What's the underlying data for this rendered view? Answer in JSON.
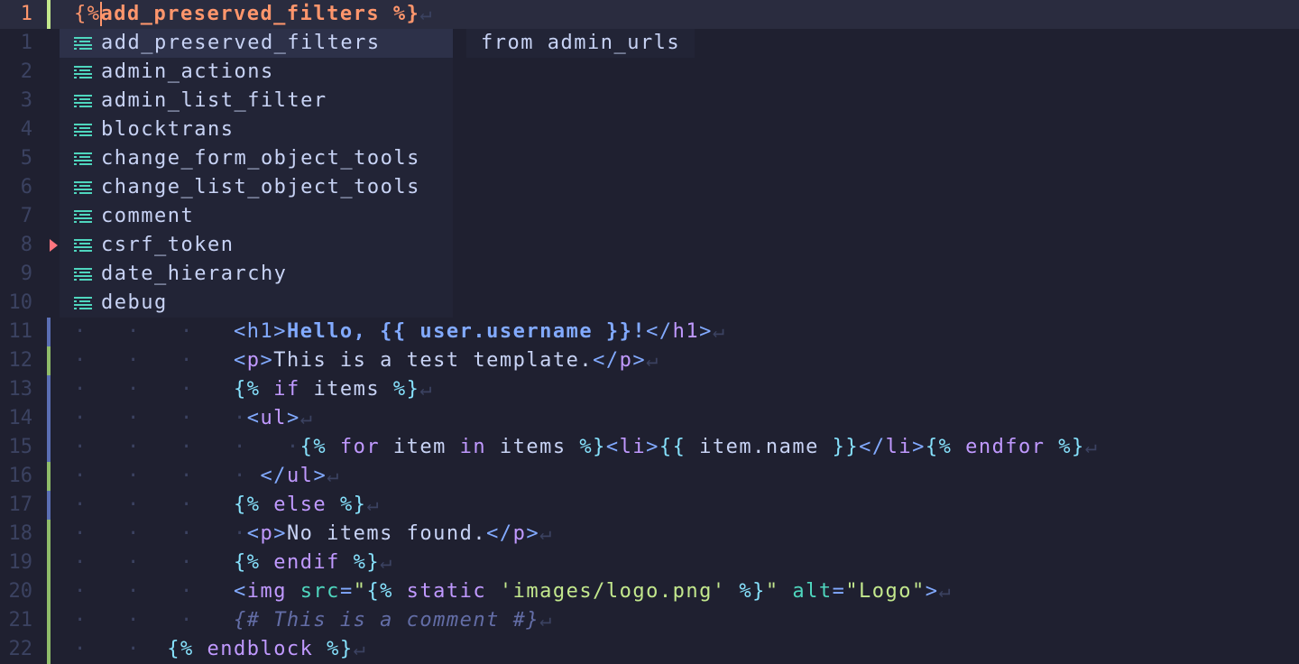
{
  "editor": {
    "current_line": {
      "number": "1",
      "open": "{%",
      "text": "add_preserved_filters",
      "close": " %}",
      "eol": "↵"
    },
    "relative_numbers": [
      "1",
      "2",
      "3",
      "4",
      "5",
      "6",
      "7",
      "8",
      "9",
      "10"
    ],
    "lines": [
      {
        "num": "11",
        "sign": "#5b6fb4",
        "tokens": [
          [
            "t-html",
            "<"
          ],
          [
            "t-html",
            "h1"
          ],
          [
            "t-html",
            ">"
          ],
          [
            "t-bold",
            "Hello, {{ user.username }}!"
          ],
          [
            "t-html",
            "</"
          ],
          [
            "t-kw",
            "h1"
          ],
          [
            "t-html",
            ">"
          ],
          [
            "t-eol",
            "↵"
          ]
        ],
        "indent": "·   ·   ·   "
      },
      {
        "num": "12",
        "sign": "#8fbc6a",
        "tokens": [
          [
            "t-html",
            "<"
          ],
          [
            "t-kw",
            "p"
          ],
          [
            "t-html",
            ">"
          ],
          [
            "t-var",
            "This is a test template."
          ],
          [
            "t-html",
            "</"
          ],
          [
            "t-kw",
            "p"
          ],
          [
            "t-html",
            ">"
          ],
          [
            "t-eol",
            "↵"
          ]
        ],
        "indent": "·   ·   ·   "
      },
      {
        "num": "13",
        "sign": "#5b6fb4",
        "tokens": [
          [
            "t-delim",
            "{%"
          ],
          [
            "t-kw",
            " if "
          ],
          [
            "t-var",
            "items"
          ],
          [
            "t-delim",
            " %}"
          ],
          [
            "t-eol",
            "↵"
          ]
        ],
        "indent": "·   ·   ·   "
      },
      {
        "num": "14",
        "sign": "#5b6fb4",
        "tokens": [
          [
            "t-html",
            "<"
          ],
          [
            "t-kw",
            "ul"
          ],
          [
            "t-html",
            ">"
          ],
          [
            "t-eol",
            "↵"
          ]
        ],
        "indent": "·   ·   ·   ·"
      },
      {
        "num": "15",
        "sign": "#5b6fb4",
        "tokens": [
          [
            "t-delim",
            "{%"
          ],
          [
            "t-kw",
            " for "
          ],
          [
            "t-var",
            "item "
          ],
          [
            "t-kw",
            "in "
          ],
          [
            "t-var",
            "items"
          ],
          [
            "t-delim",
            " %}"
          ],
          [
            "t-html",
            "<"
          ],
          [
            "t-kw",
            "li"
          ],
          [
            "t-html",
            ">"
          ],
          [
            "t-delim",
            "{{"
          ],
          [
            "t-var",
            " item.name "
          ],
          [
            "t-delim",
            "}}"
          ],
          [
            "t-html",
            "</"
          ],
          [
            "t-kw",
            "li"
          ],
          [
            "t-html",
            ">"
          ],
          [
            "t-delim",
            "{%"
          ],
          [
            "t-kw",
            " endfor"
          ],
          [
            "t-delim",
            " %}"
          ],
          [
            "t-eol",
            "↵"
          ]
        ],
        "indent": "·   ·   ·   ·   ·"
      },
      {
        "num": "16",
        "sign": "#8fbc6a",
        "tokens": [
          [
            "t-html",
            "</"
          ],
          [
            "t-kw",
            "ul"
          ],
          [
            "t-html",
            ">"
          ],
          [
            "t-eol",
            "↵"
          ]
        ],
        "indent": "·   ·   ·   · "
      },
      {
        "num": "17",
        "sign": "#5b6fb4",
        "tokens": [
          [
            "t-delim",
            "{%"
          ],
          [
            "t-kw",
            " else "
          ],
          [
            "t-delim",
            "%}"
          ],
          [
            "t-eol",
            "↵"
          ]
        ],
        "indent": "·   ·   ·   "
      },
      {
        "num": "18",
        "sign": "#8fbc6a",
        "tokens": [
          [
            "t-html",
            "<"
          ],
          [
            "t-kw",
            "p"
          ],
          [
            "t-html",
            ">"
          ],
          [
            "t-var",
            "No items found."
          ],
          [
            "t-html",
            "</"
          ],
          [
            "t-kw",
            "p"
          ],
          [
            "t-html",
            ">"
          ],
          [
            "t-eol",
            "↵"
          ]
        ],
        "indent": "·   ·   ·   ·"
      },
      {
        "num": "19",
        "sign": "#8fbc6a",
        "tokens": [
          [
            "t-delim",
            "{%"
          ],
          [
            "t-kw",
            " endif "
          ],
          [
            "t-delim",
            "%}"
          ],
          [
            "t-eol",
            "↵"
          ]
        ],
        "indent": "·   ·   ·   "
      },
      {
        "num": "20",
        "sign": "#8fbc6a",
        "tokens": [
          [
            "t-html",
            "<"
          ],
          [
            "t-kw",
            "img "
          ],
          [
            "t-attr",
            "src"
          ],
          [
            "t-html",
            "="
          ],
          [
            "t-str",
            "\""
          ],
          [
            "t-delim",
            "{%"
          ],
          [
            "t-kw",
            " static "
          ],
          [
            "t-str",
            "'images/logo.png'"
          ],
          [
            "t-delim",
            " %}"
          ],
          [
            "t-str",
            "\""
          ],
          [
            "t-attr",
            " alt"
          ],
          [
            "t-html",
            "="
          ],
          [
            "t-str",
            "\"Logo\""
          ],
          [
            "t-html",
            ">"
          ],
          [
            "t-eol",
            "↵"
          ]
        ],
        "indent": "·   ·   ·   "
      },
      {
        "num": "21",
        "sign": "#8fbc6a",
        "tokens": [
          [
            "t-comment",
            "{# This is a comment #}"
          ],
          [
            "t-eol",
            "↵"
          ]
        ],
        "indent": "·   ·   ·   "
      },
      {
        "num": "22",
        "sign": "#8fbc6a",
        "tokens": [
          [
            "t-delim",
            "{%"
          ],
          [
            "t-kw",
            " endblock "
          ],
          [
            "t-delim",
            "%}"
          ],
          [
            "t-eol",
            "↵"
          ]
        ],
        "indent": "·   ·  "
      }
    ]
  },
  "completion": {
    "selected_index": 0,
    "items": [
      "add_preserved_filters",
      "admin_actions",
      "admin_list_filter",
      "blocktrans",
      "change_form_object_tools",
      "change_list_object_tools",
      "comment",
      "csrf_token",
      "date_hierarchy",
      "debug"
    ],
    "item_icon": "text-snippet-icon",
    "doc": "from admin_urls"
  },
  "colors": {
    "background": "#1f2030",
    "current_line_number": "#ff966c",
    "git_added": "#8fbc6a",
    "git_changed": "#5b6fb4",
    "breakpoint": "#ff757f"
  }
}
